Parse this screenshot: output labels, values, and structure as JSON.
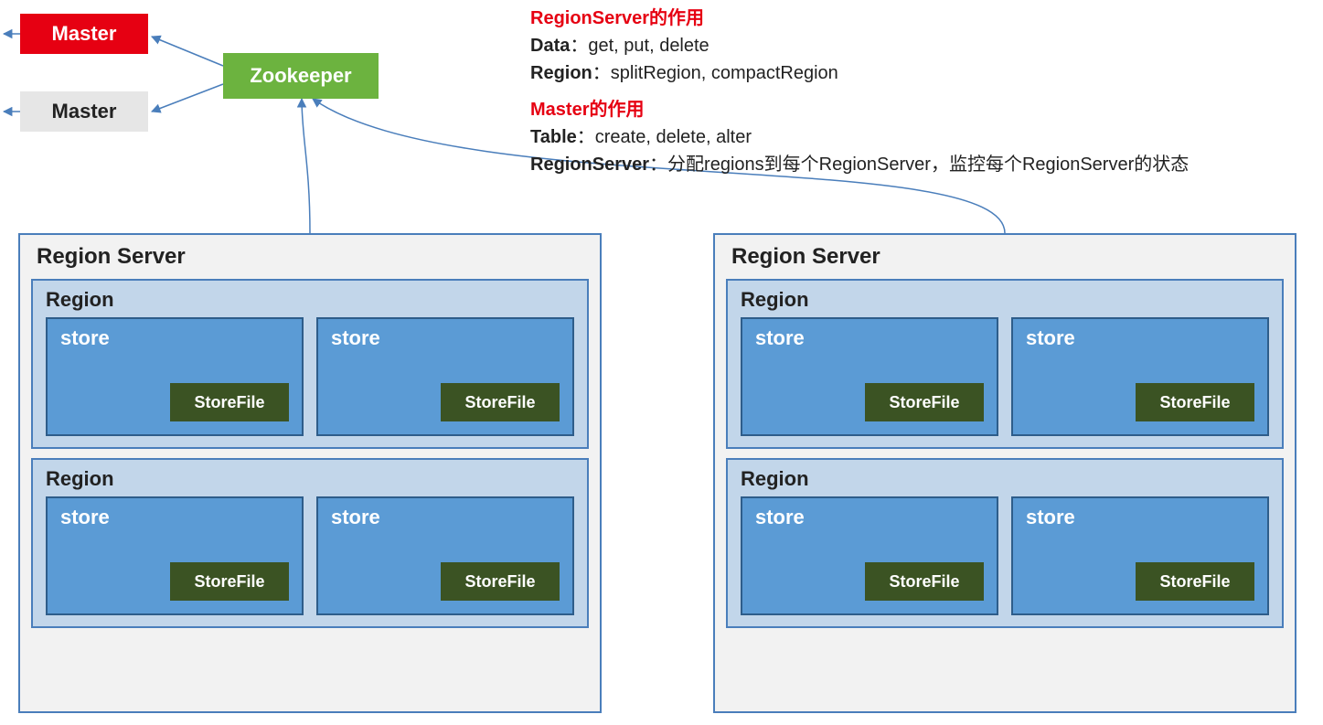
{
  "nodes": {
    "master_active": "Master",
    "master_standby": "Master",
    "zookeeper": "Zookeeper"
  },
  "annotations": {
    "rs_title": "RegionServer的作用",
    "rs_line1_key": "Data",
    "rs_line1_val": "：get, put, delete",
    "rs_line2_key": "Region",
    "rs_line2_val": "：splitRegion, compactRegion",
    "master_title": "Master的作用",
    "master_line1_key": "Table",
    "master_line1_val": "：create, delete, alter",
    "master_line2_key": "RegionServer",
    "master_line2_val": "：分配regions到每个RegionServer，监控每个RegionServer的状态"
  },
  "region_server": {
    "title": "Region Server",
    "region_title": "Region",
    "store_title": "store",
    "storefile_title": "StoreFile"
  }
}
